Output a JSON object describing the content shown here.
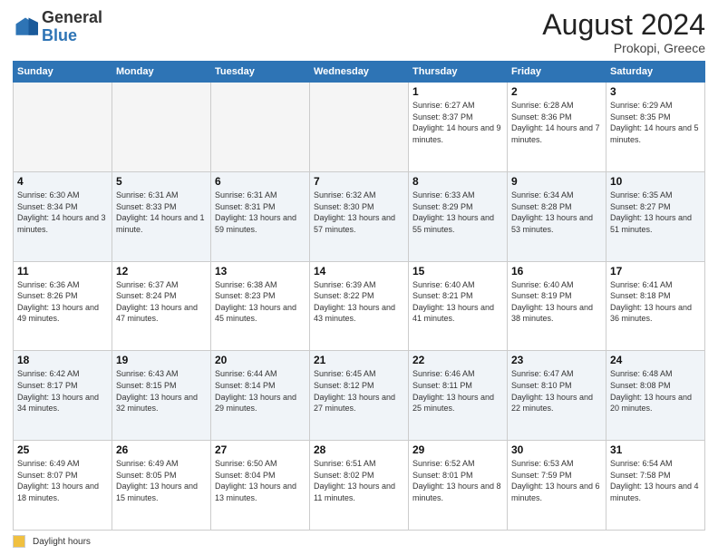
{
  "header": {
    "logo_general": "General",
    "logo_blue": "Blue",
    "title": "August 2024",
    "location": "Prokopi, Greece"
  },
  "legend": {
    "box_label": "Daylight hours"
  },
  "days_of_week": [
    "Sunday",
    "Monday",
    "Tuesday",
    "Wednesday",
    "Thursday",
    "Friday",
    "Saturday"
  ],
  "weeks": [
    [
      {
        "day": "",
        "info": ""
      },
      {
        "day": "",
        "info": ""
      },
      {
        "day": "",
        "info": ""
      },
      {
        "day": "",
        "info": ""
      },
      {
        "day": "1",
        "info": "Sunrise: 6:27 AM\nSunset: 8:37 PM\nDaylight: 14 hours and 9 minutes."
      },
      {
        "day": "2",
        "info": "Sunrise: 6:28 AM\nSunset: 8:36 PM\nDaylight: 14 hours and 7 minutes."
      },
      {
        "day": "3",
        "info": "Sunrise: 6:29 AM\nSunset: 8:35 PM\nDaylight: 14 hours and 5 minutes."
      }
    ],
    [
      {
        "day": "4",
        "info": "Sunrise: 6:30 AM\nSunset: 8:34 PM\nDaylight: 14 hours and 3 minutes."
      },
      {
        "day": "5",
        "info": "Sunrise: 6:31 AM\nSunset: 8:33 PM\nDaylight: 14 hours and 1 minute."
      },
      {
        "day": "6",
        "info": "Sunrise: 6:31 AM\nSunset: 8:31 PM\nDaylight: 13 hours and 59 minutes."
      },
      {
        "day": "7",
        "info": "Sunrise: 6:32 AM\nSunset: 8:30 PM\nDaylight: 13 hours and 57 minutes."
      },
      {
        "day": "8",
        "info": "Sunrise: 6:33 AM\nSunset: 8:29 PM\nDaylight: 13 hours and 55 minutes."
      },
      {
        "day": "9",
        "info": "Sunrise: 6:34 AM\nSunset: 8:28 PM\nDaylight: 13 hours and 53 minutes."
      },
      {
        "day": "10",
        "info": "Sunrise: 6:35 AM\nSunset: 8:27 PM\nDaylight: 13 hours and 51 minutes."
      }
    ],
    [
      {
        "day": "11",
        "info": "Sunrise: 6:36 AM\nSunset: 8:26 PM\nDaylight: 13 hours and 49 minutes."
      },
      {
        "day": "12",
        "info": "Sunrise: 6:37 AM\nSunset: 8:24 PM\nDaylight: 13 hours and 47 minutes."
      },
      {
        "day": "13",
        "info": "Sunrise: 6:38 AM\nSunset: 8:23 PM\nDaylight: 13 hours and 45 minutes."
      },
      {
        "day": "14",
        "info": "Sunrise: 6:39 AM\nSunset: 8:22 PM\nDaylight: 13 hours and 43 minutes."
      },
      {
        "day": "15",
        "info": "Sunrise: 6:40 AM\nSunset: 8:21 PM\nDaylight: 13 hours and 41 minutes."
      },
      {
        "day": "16",
        "info": "Sunrise: 6:40 AM\nSunset: 8:19 PM\nDaylight: 13 hours and 38 minutes."
      },
      {
        "day": "17",
        "info": "Sunrise: 6:41 AM\nSunset: 8:18 PM\nDaylight: 13 hours and 36 minutes."
      }
    ],
    [
      {
        "day": "18",
        "info": "Sunrise: 6:42 AM\nSunset: 8:17 PM\nDaylight: 13 hours and 34 minutes."
      },
      {
        "day": "19",
        "info": "Sunrise: 6:43 AM\nSunset: 8:15 PM\nDaylight: 13 hours and 32 minutes."
      },
      {
        "day": "20",
        "info": "Sunrise: 6:44 AM\nSunset: 8:14 PM\nDaylight: 13 hours and 29 minutes."
      },
      {
        "day": "21",
        "info": "Sunrise: 6:45 AM\nSunset: 8:12 PM\nDaylight: 13 hours and 27 minutes."
      },
      {
        "day": "22",
        "info": "Sunrise: 6:46 AM\nSunset: 8:11 PM\nDaylight: 13 hours and 25 minutes."
      },
      {
        "day": "23",
        "info": "Sunrise: 6:47 AM\nSunset: 8:10 PM\nDaylight: 13 hours and 22 minutes."
      },
      {
        "day": "24",
        "info": "Sunrise: 6:48 AM\nSunset: 8:08 PM\nDaylight: 13 hours and 20 minutes."
      }
    ],
    [
      {
        "day": "25",
        "info": "Sunrise: 6:49 AM\nSunset: 8:07 PM\nDaylight: 13 hours and 18 minutes."
      },
      {
        "day": "26",
        "info": "Sunrise: 6:49 AM\nSunset: 8:05 PM\nDaylight: 13 hours and 15 minutes."
      },
      {
        "day": "27",
        "info": "Sunrise: 6:50 AM\nSunset: 8:04 PM\nDaylight: 13 hours and 13 minutes."
      },
      {
        "day": "28",
        "info": "Sunrise: 6:51 AM\nSunset: 8:02 PM\nDaylight: 13 hours and 11 minutes."
      },
      {
        "day": "29",
        "info": "Sunrise: 6:52 AM\nSunset: 8:01 PM\nDaylight: 13 hours and 8 minutes."
      },
      {
        "day": "30",
        "info": "Sunrise: 6:53 AM\nSunset: 7:59 PM\nDaylight: 13 hours and 6 minutes."
      },
      {
        "day": "31",
        "info": "Sunrise: 6:54 AM\nSunset: 7:58 PM\nDaylight: 13 hours and 4 minutes."
      }
    ]
  ]
}
